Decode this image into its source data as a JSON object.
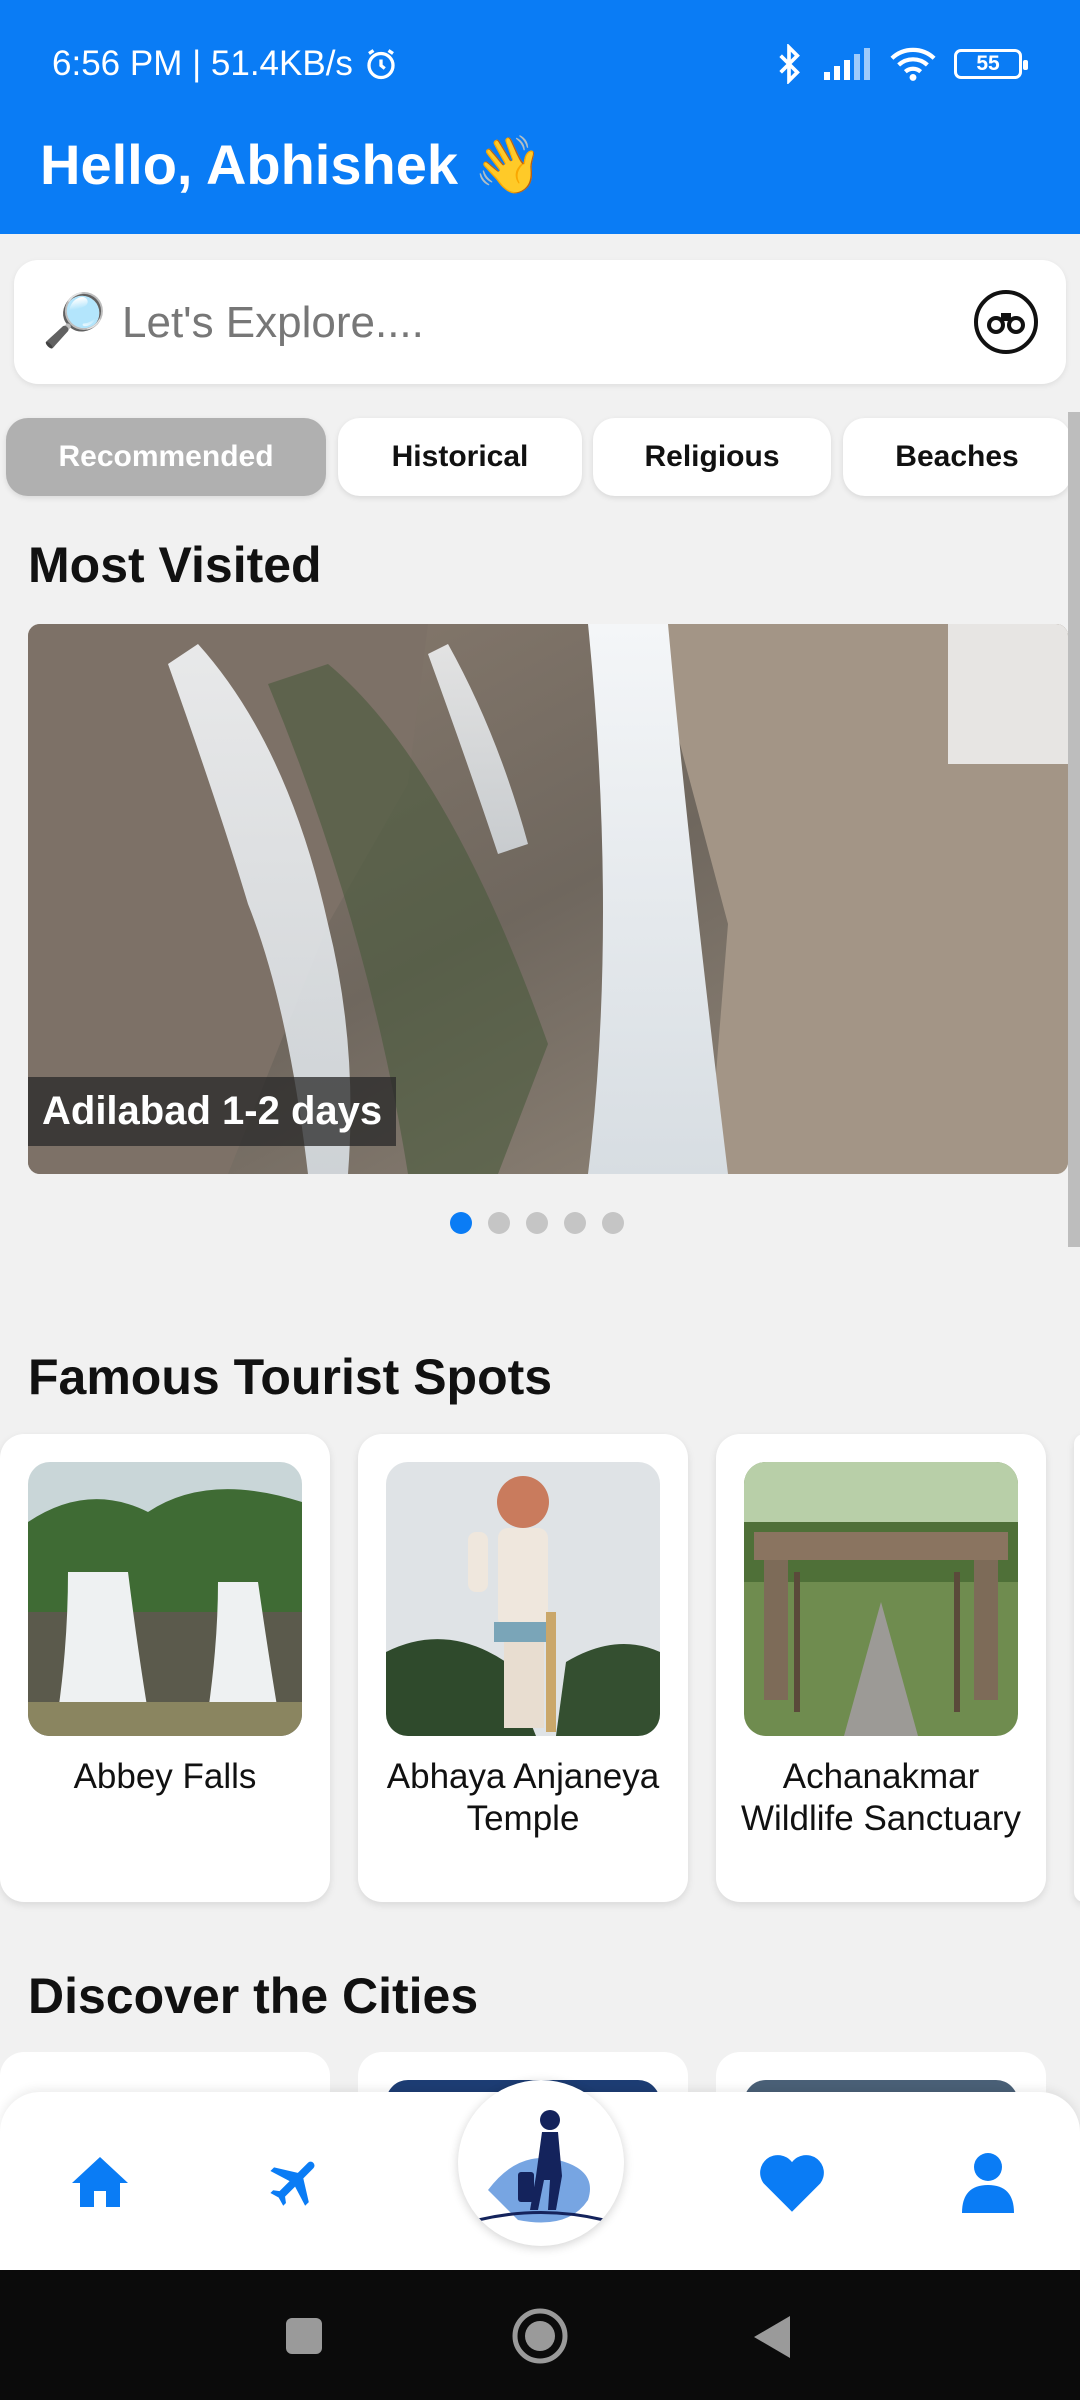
{
  "status_bar": {
    "time": "6:56 PM | 51.4KB/s",
    "battery": "55"
  },
  "header": {
    "greeting": "Hello, Abhishek 👋"
  },
  "search": {
    "placeholder": "Let's Explore....",
    "icon": "🔎"
  },
  "categories": [
    {
      "label": "Recommended",
      "active": true
    },
    {
      "label": "Historical",
      "active": false
    },
    {
      "label": "Religious",
      "active": false
    },
    {
      "label": "Beaches",
      "active": false
    }
  ],
  "most_visited": {
    "title": "Most Visited",
    "caption": "Adilabad 1-2 days",
    "slide_count": 5,
    "active_slide": 1
  },
  "tourist_spots": {
    "title": "Famous Tourist Spots",
    "items": [
      {
        "name": "Abbey Falls"
      },
      {
        "name": "Abhaya Anjaneya Temple"
      },
      {
        "name": "Achanakmar Wildlife Sanctuary"
      }
    ]
  },
  "cities": {
    "title": "Discover the Cities"
  },
  "colors": {
    "accent": "#0a7cf5",
    "background": "#f1f1f1",
    "chip_active": "#b0b0b0"
  },
  "bottom_nav": {
    "items": [
      "home-icon",
      "plane-icon",
      "traveler-logo",
      "heart-icon",
      "user-icon"
    ]
  }
}
